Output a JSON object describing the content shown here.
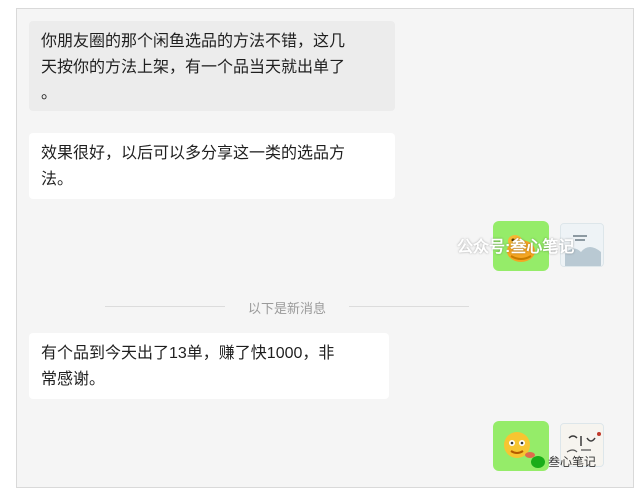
{
  "messages": [
    {
      "text": "你朋友圈的那个闲鱼选品的方法不错，这几\n天按你的方法上架，有一个品当天就出单了\n。"
    },
    {
      "text": "效果很好，以后可以多分享这一类的选品方\n法。"
    },
    {
      "text": "有个品到今天出了13单，赚了快1000，非\n常感谢。"
    }
  ],
  "divider": {
    "label": "以下是新消息"
  },
  "watermark_top": "公众号:叁心笔记",
  "watermark_bottom": "叁心笔记",
  "colors": {
    "sticker_bg": "#95ec69",
    "bubble_in": "#ffffff",
    "chat_bg": "#f5f5f5"
  }
}
